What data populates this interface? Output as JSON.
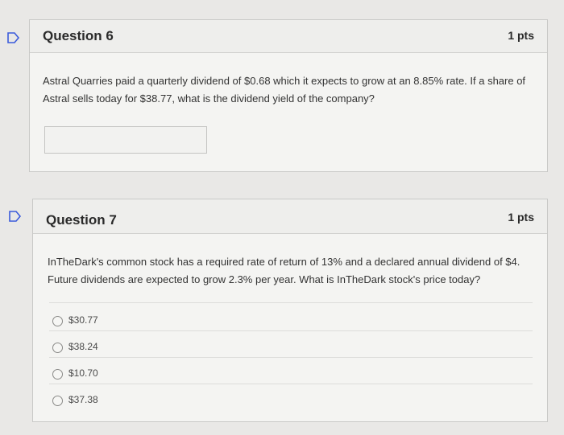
{
  "questions": [
    {
      "title": "Question 6",
      "points": "1 pts",
      "text": "Astral Quarries paid a quarterly dividend of $0.68 which it expects to grow at an 8.85% rate. If a share of Astral sells today for $38.77, what is the dividend yield of the company?",
      "answer_value": ""
    },
    {
      "title": "Question 7",
      "points": "1 pts",
      "text": "InTheDark's common stock has a required rate of return of 13% and a declared annual dividend of $4. Future dividends are expected to grow 2.3% per year. What is InTheDark stock's price today?",
      "options": [
        "$30.77",
        "$38.24",
        "$10.70",
        "$37.38"
      ]
    }
  ],
  "colors": {
    "flag": "#3b5bdb"
  }
}
